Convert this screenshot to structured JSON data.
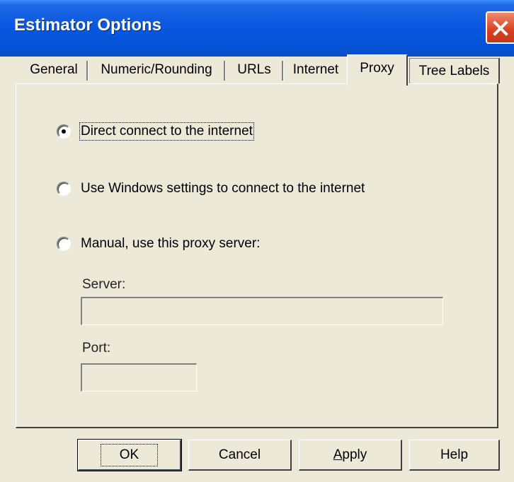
{
  "window": {
    "title": "Estimator Options",
    "close_icon": "close-icon"
  },
  "tabs": [
    {
      "label": "General"
    },
    {
      "label": "Numeric/Rounding"
    },
    {
      "label": "URLs"
    },
    {
      "label": "Internet"
    },
    {
      "label": "Proxy",
      "active": true
    },
    {
      "label": "Tree Labels"
    }
  ],
  "proxy": {
    "options": [
      {
        "label": "Direct connect to the internet",
        "selected": true
      },
      {
        "label": "Use Windows settings to connect to the internet",
        "selected": false
      },
      {
        "label": "Manual, use this proxy server:",
        "selected": false
      }
    ],
    "server_label": "Server:",
    "server_value": "",
    "port_label": "Port:",
    "port_value": ""
  },
  "buttons": {
    "ok": "OK",
    "cancel": "Cancel",
    "apply_underlined": "A",
    "apply_rest": "pply",
    "help": "Help"
  },
  "colors": {
    "titlebar": "#0a58e0",
    "dialog_bg": "#ece9d8",
    "close_button": "#d8401e"
  }
}
